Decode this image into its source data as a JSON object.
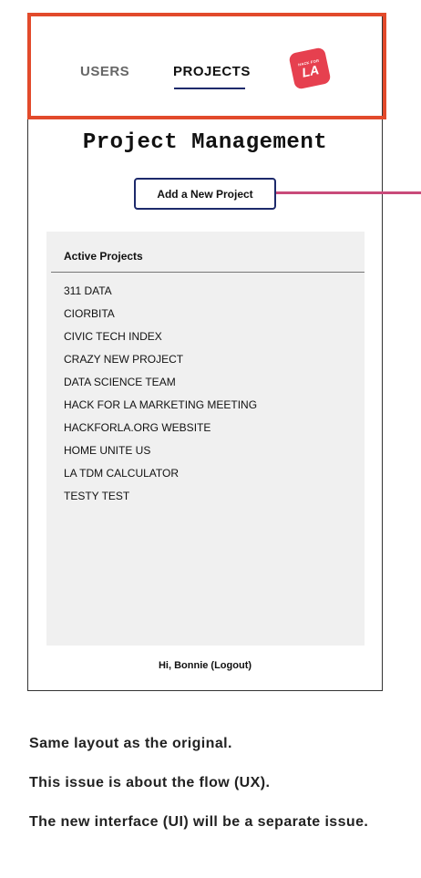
{
  "nav": {
    "tabs": [
      "USERS",
      "PROJECTS"
    ],
    "active_tab": "PROJECTS",
    "logo": {
      "text_top": "HACK FOR",
      "text_main": "LA",
      "color": "#e6404f"
    }
  },
  "main": {
    "title": "Project Management",
    "add_button_label": "Add a New Project",
    "panel_title": "Active Projects",
    "projects": [
      "311 DATA",
      "CIORBITA",
      "CIVIC TECH INDEX",
      "CRAZY NEW PROJECT",
      "DATA SCIENCE TEAM",
      "HACK FOR LA MARKETING MEETING",
      "HACKFORLA.ORG WEBSITE",
      "HOME UNITE US",
      "LA TDM CALCULATOR",
      "TESTY TEST"
    ],
    "greeting": "Hi, Bonnie (Logout)"
  },
  "notes": [
    "Same layout as the original.",
    "This issue is about the flow (UX).",
    "The new interface (UI) will be a separate issue."
  ],
  "colors": {
    "highlight": "#e24a2b",
    "pointer": "#c94a7a",
    "accent": "#1d2a6b"
  }
}
